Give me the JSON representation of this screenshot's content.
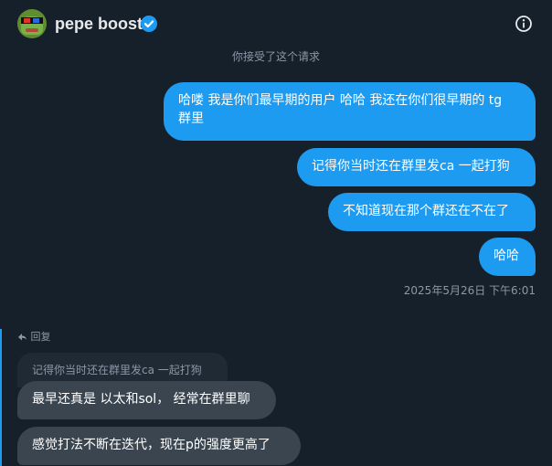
{
  "header": {
    "title": "pepe boost",
    "avatar_icon": "pepe-avatar",
    "verified_icon": "verified-badge-icon",
    "info_icon": "info-icon"
  },
  "system_message": "你接受了这个请求",
  "messages_out": [
    {
      "line1": "哈喽 我是你们最早期的用户 哈哈 我还在你们很早期的 tg",
      "line2": "群里"
    },
    {
      "text": "记得你当时还在群里发ca 一起打狗"
    },
    {
      "text": "不知道现在那个群还在不在了"
    },
    {
      "text": "哈哈"
    }
  ],
  "timestamp": "2025年5月26日 下午6:01",
  "reply": {
    "label": "回复",
    "quoted": "记得你当时还在群里发ca 一起打狗"
  },
  "messages_in": [
    {
      "text": "最早还真是 以太和sol， 经常在群里聊"
    },
    {
      "text": "感觉打法不断在迭代，现在p的强度更高了"
    }
  ],
  "colors": {
    "background": "#15202b",
    "outgoing_bubble": "#1d9bf0",
    "incoming_bubble": "#3a4550",
    "muted_text": "#8b98a5"
  }
}
